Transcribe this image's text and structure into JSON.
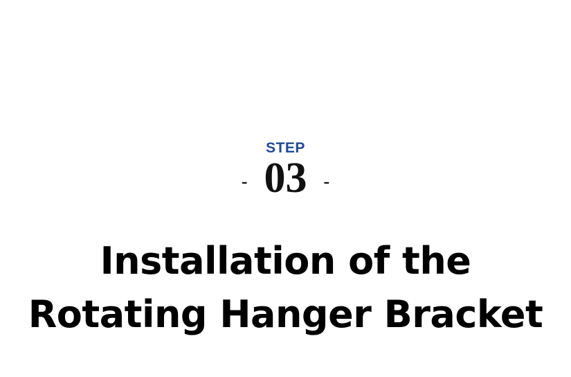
{
  "step": {
    "label": "STEP",
    "number": "03",
    "dash_left": "-",
    "dash_right": "-"
  },
  "heading": {
    "line1": "Installation of the",
    "line2": "Rotating Hanger Bracket"
  },
  "colors": {
    "step_label": "#1f4a9e",
    "text": "#000000",
    "background": "#ffffff"
  }
}
